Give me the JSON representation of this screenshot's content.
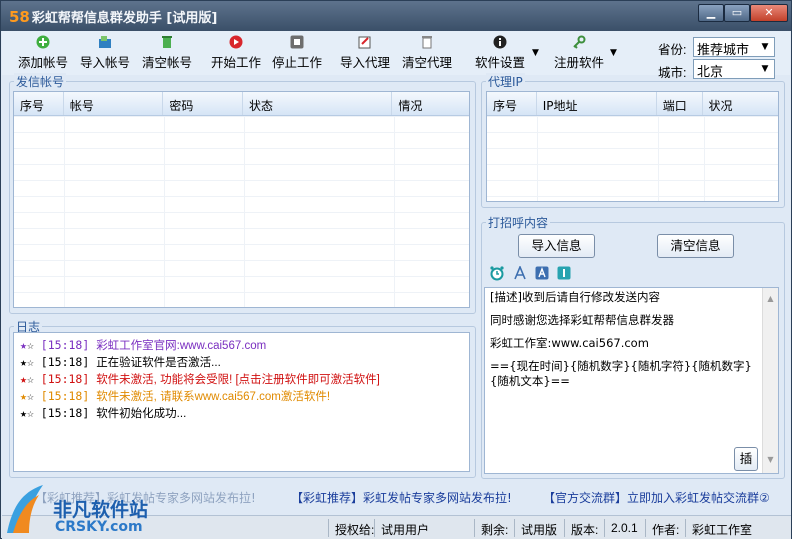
{
  "window": {
    "title_num": "58",
    "title": "彩虹帮帮信息群发助手 [试用版]",
    "min": "▁",
    "max": "▭",
    "close": "✕"
  },
  "toolbar": {
    "add_account": "添加帐号",
    "import_account": "导入帐号",
    "clear_account": "清空帐号",
    "start": "开始工作",
    "stop": "停止工作",
    "import_proxy": "导入代理",
    "clear_proxy": "清空代理",
    "settings": "软件设置",
    "register": "注册软件"
  },
  "location": {
    "province_label": "省份:",
    "province_value": "推荐城市",
    "city_label": "城市:",
    "city_value": "北京"
  },
  "accounts": {
    "title": "发信帐号",
    "columns": [
      "序号",
      "帐号",
      "密码",
      "状态",
      "情况"
    ]
  },
  "proxy": {
    "title": "代理IP",
    "columns": [
      "序号",
      "IP地址",
      "端口",
      "状况"
    ]
  },
  "greeting": {
    "title": "打招呼内容",
    "import_btn": "导入信息",
    "clear_btn": "清空信息",
    "lines": [
      "[描述]收到后请自行修改发送内容",
      "同时感谢您选择彩虹帮帮信息群发器",
      "彩虹工作室:www.cai567.com",
      "=={现在时间}{随机数字}{随机字符}{随机数字}{随机文本}=="
    ],
    "insert_btn": "插"
  },
  "log": {
    "title": "日志",
    "lines": [
      {
        "time": "[15:18]",
        "text": "彩虹工作室官网:www.cai567.com",
        "star_color": "#7a2fc0",
        "color": "#7a2fc0"
      },
      {
        "time": "[15:18]",
        "text": "正在验证软件是否激活...",
        "star_color": "#000000",
        "color": "#000000"
      },
      {
        "time": "[15:18]",
        "text": "软件未激活, 功能将会受限! [点击注册软件即可激活软件]",
        "star_color": "#d01010",
        "color": "#d01010"
      },
      {
        "time": "[15:18]",
        "text": "软件未激活, 请联系www.cai567.com激活软件!",
        "star_color": "#e08a00",
        "color": "#e08a00"
      },
      {
        "time": "[15:18]",
        "text": "软件初始化成功...",
        "star_color": "#000000",
        "color": "#000000"
      }
    ]
  },
  "ads": {
    "left": "【彩虹推荐】彩虹发帖专家多网站发布拉!",
    "middle": "【彩虹推荐】彩虹发帖专家多网站发布拉!",
    "right": "【官方交流群】立即加入彩虹发帖交流群②"
  },
  "status": {
    "auth_label": "授权给:",
    "auth_value": "试用用户",
    "remain_label": "剩余:",
    "remain_value": "试用版",
    "version_label": "版本:",
    "version_value": "2.0.1",
    "author_label": "作者:",
    "author_value": "彩虹工作室"
  },
  "watermark": {
    "cn": "非凡软件站",
    "en": "CRSKY.com"
  },
  "colors": {
    "accent": "#2c5a9a",
    "title_bg": "#4a6079",
    "window_bg": "#dfe9f5"
  }
}
